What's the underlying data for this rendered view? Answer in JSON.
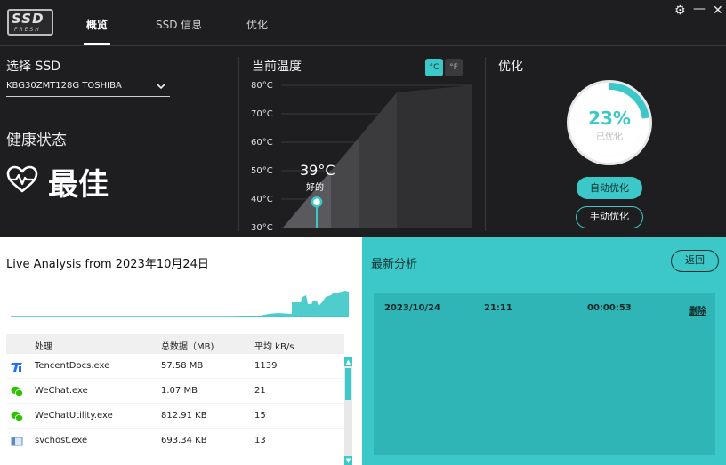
{
  "app": {
    "logo_main": "SSD",
    "logo_sub": "FRESH",
    "tabs": [
      {
        "label": "概览",
        "active": true
      },
      {
        "label": "SSD 信息",
        "active": false
      },
      {
        "label": "优化",
        "active": false
      }
    ],
    "window_controls": {
      "settings": "⚙",
      "minimize": "—",
      "close": "✕"
    }
  },
  "ssd": {
    "select_label": "选择 SSD",
    "selected_drive": "KBG30ZMT128G TOSHIBA"
  },
  "health": {
    "label": "健康状态",
    "value": "最佳",
    "icon": "heartbeat-icon"
  },
  "temperature": {
    "title": "当前温度",
    "unit_c": "°C",
    "unit_f": "°F",
    "active_unit": "C",
    "ticks": [
      "80°C",
      "70°C",
      "60°C",
      "50°C",
      "40°C",
      "30°C"
    ],
    "value": "39°C",
    "value_number": 39,
    "status": "好的"
  },
  "optimize": {
    "title": "优化",
    "percent": "23%",
    "percent_value": 23,
    "percent_label": "已优化",
    "auto_button": "自动优化",
    "manual_button": "手动优化"
  },
  "live": {
    "title": "Live Analysis from 2023年10月24日",
    "columns": [
      "处理",
      "总数据（MB)",
      "平均 kB/s"
    ],
    "rows": [
      {
        "name": "TencentDocs.exe",
        "total": "57.58 MB",
        "avg": "1139",
        "icon": "tencent-docs-icon"
      },
      {
        "name": "WeChat.exe",
        "total": "1.07 MB",
        "avg": "21",
        "icon": "wechat-icon"
      },
      {
        "name": "WeChatUtility.exe",
        "total": "812.91 KB",
        "avg": "15",
        "icon": "wechat-icon"
      },
      {
        "name": "svchost.exe",
        "total": "693.34 KB",
        "avg": "13",
        "icon": "svchost-icon"
      }
    ]
  },
  "recent": {
    "title": "最新分析",
    "back_button": "返回",
    "entries": [
      {
        "date": "2023/10/24",
        "time": "21:11",
        "duration": "00:00:53",
        "delete": "删除"
      }
    ]
  },
  "colors": {
    "accent": "#3cc8c8",
    "dark_bg": "#1e1e20"
  }
}
